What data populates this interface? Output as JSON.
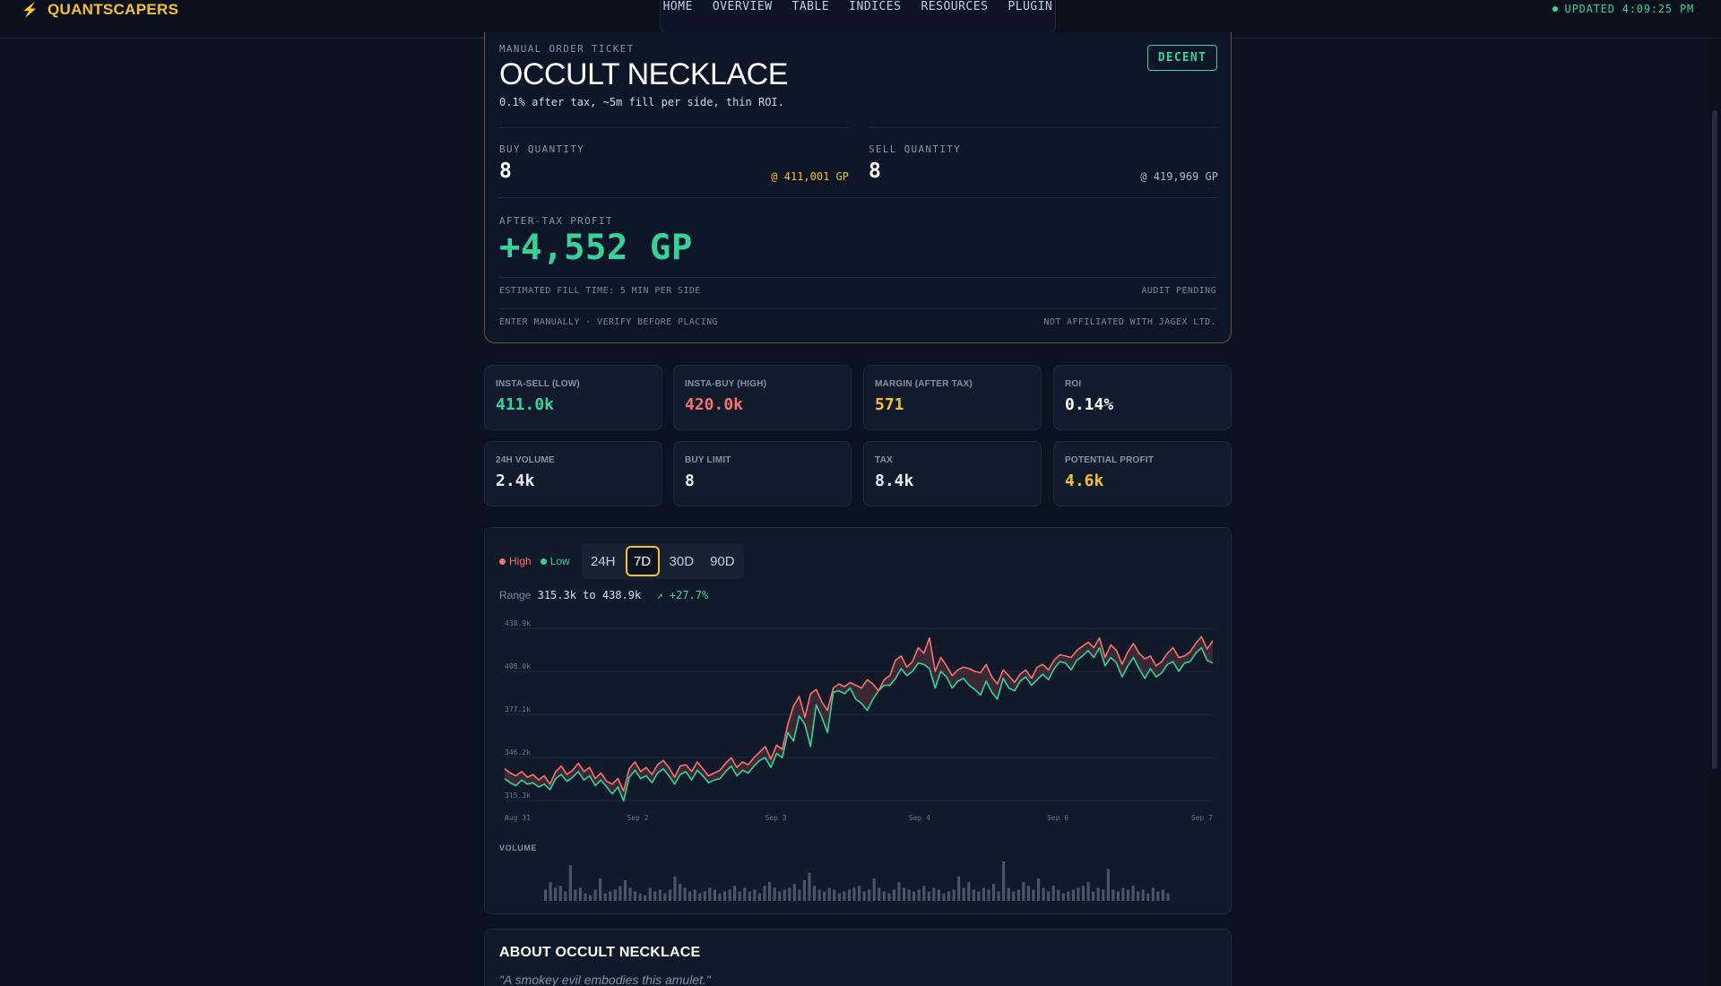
{
  "brand": {
    "name": "QUANTSCAPERS",
    "icon": "lightning-bolt-icon"
  },
  "nav": [
    "HOME",
    "OVERVIEW",
    "TABLE",
    "INDICES",
    "RESOURCES",
    "PLUGIN"
  ],
  "status": {
    "updated": "UPDATED 4:09:25 PM"
  },
  "ticket": {
    "eyebrow": "MANUAL ORDER TICKET",
    "title": "OCCULT NECKLACE",
    "subtitle": "0.1% after tax, ~5m fill per side, thin ROI.",
    "badge": "DECENT",
    "buy_label": "BUY QUANTITY",
    "buy_qty": "8",
    "buy_price": "@ 411,001 GP",
    "sell_label": "SELL QUANTITY",
    "sell_qty": "8",
    "sell_price": "@ 419,969 GP",
    "profit_label": "AFTER-TAX PROFIT",
    "profit": "+4,552 GP",
    "fill_time": "ESTIMATED FILL TIME: 5 MIN PER SIDE",
    "audit": "AUDIT PENDING",
    "manual_note": "ENTER MANUALLY · VERIFY BEFORE PLACING",
    "disclaimer": "NOT AFFILIATED WITH JAGEX LTD."
  },
  "stats": [
    {
      "label": "INSTA-SELL (LOW)",
      "value": "411.0k",
      "color": "#34d399"
    },
    {
      "label": "INSTA-BUY (HIGH)",
      "value": "420.0k",
      "color": "#f87171"
    },
    {
      "label": "MARGIN (AFTER TAX)",
      "value": "571",
      "color": "#f5c130"
    },
    {
      "label": "ROI",
      "value": "0.14%",
      "color": "#ffffff"
    },
    {
      "label": "24H VOLUME",
      "value": "2.4k",
      "color": "#e6ebf2"
    },
    {
      "label": "BUY LIMIT",
      "value": "8",
      "color": "#e6ebf2"
    },
    {
      "label": "TAX",
      "value": "8.4k",
      "color": "#e6ebf2"
    },
    {
      "label": "POTENTIAL PROFIT",
      "value": "4.6k",
      "color": "#f5c130"
    }
  ],
  "chart": {
    "legend_high": "High",
    "legend_low": "Low",
    "periods": [
      "24H",
      "7D",
      "30D",
      "90D"
    ],
    "active_period": "7D",
    "range_prefix": "Range",
    "range_text": "315.3k to 438.9k",
    "range_change": "↗ +27.7%",
    "volume_label": "VOLUME"
  },
  "chart_data": {
    "type": "line",
    "ylim": [
      315.3,
      438.9
    ],
    "y_ticks": [
      "438.9k",
      "408.0k",
      "377.1k",
      "346.2k",
      "315.3k"
    ],
    "x_ticks": [
      "Aug 31",
      "Sep 2",
      "Sep 3",
      "Sep 4",
      "Sep 6",
      "Sep 7"
    ],
    "x_tick_positions": [
      0,
      0.188,
      0.383,
      0.586,
      0.781,
      1.0
    ],
    "colors": {
      "high": "#f87171",
      "low": "#34d399",
      "volume": "#4b5563"
    },
    "series": [
      {
        "name": "High",
        "values": [
          338,
          335,
          333,
          336,
          332,
          334,
          330,
          333,
          327,
          336,
          340,
          334,
          337,
          342,
          336,
          339,
          331,
          335,
          329,
          327,
          331,
          322,
          338,
          343,
          336,
          339,
          334,
          341,
          344,
          339,
          332,
          340,
          341,
          336,
          343,
          338,
          333,
          335,
          337,
          342,
          346,
          339,
          343,
          341,
          346,
          350,
          354,
          345,
          355,
          352,
          370,
          383,
          390,
          375,
          392,
          395,
          386,
          380,
          396,
          399,
          397,
          400,
          398,
          396,
          402,
          399,
          394,
          402,
          405,
          416,
          419,
          411,
          415,
          425,
          421,
          432,
          408,
          418,
          412,
          405,
          409,
          411,
          410,
          408,
          407,
          413,
          404,
          399,
          409,
          405,
          400,
          406,
          409,
          403,
          411,
          413,
          409,
          416,
          420,
          419,
          418,
          423,
          426,
          429,
          425,
          432,
          418,
          427,
          423,
          413,
          422,
          428,
          421,
          417,
          419,
          412,
          415,
          421,
          425,
          418,
          419,
          422,
          428,
          433,
          424,
          430
        ],
        "note": ""
      },
      {
        "name": "Low",
        "values": [
          331,
          328,
          326,
          330,
          327,
          328,
          325,
          327,
          323,
          331,
          334,
          329,
          332,
          336,
          330,
          333,
          326,
          330,
          325,
          320,
          325,
          315,
          332,
          337,
          331,
          333,
          328,
          335,
          338,
          333,
          327,
          334,
          336,
          330,
          337,
          333,
          328,
          330,
          331,
          336,
          340,
          333,
          337,
          335,
          340,
          344,
          346,
          339,
          349,
          346,
          364,
          358,
          376,
          370,
          354,
          384,
          375,
          364,
          393,
          394,
          392,
          396,
          388,
          385,
          380,
          388,
          394,
          398,
          398,
          403,
          410,
          405,
          408,
          414,
          413,
          410,
          396,
          408,
          404,
          396,
          401,
          403,
          398,
          395,
          391,
          401,
          393,
          388,
          403,
          396,
          394,
          401,
          404,
          398,
          402,
          406,
          402,
          410,
          415,
          414,
          409,
          416,
          419,
          423,
          418,
          425,
          412,
          418,
          414,
          404,
          412,
          418,
          410,
          403,
          410,
          404,
          407,
          413,
          415,
          408,
          414,
          415,
          421,
          425,
          416,
          414
        ]
      }
    ],
    "volume": [
      12,
      20,
      14,
      16,
      10,
      38,
      12,
      14,
      8,
      6,
      12,
      24,
      8,
      10,
      12,
      16,
      22,
      14,
      10,
      8,
      6,
      14,
      10,
      12,
      8,
      12,
      26,
      18,
      14,
      10,
      12,
      8,
      10,
      14,
      12,
      8,
      10,
      12,
      16,
      10,
      14,
      10,
      12,
      8,
      16,
      20,
      14,
      10,
      12,
      14,
      18,
      12,
      22,
      30,
      16,
      12,
      10,
      14,
      12,
      8,
      10,
      12,
      14,
      16,
      10,
      12,
      24,
      14,
      10,
      8,
      12,
      20,
      14,
      12,
      10,
      12,
      16,
      10,
      14,
      12,
      8,
      10,
      12,
      26,
      14,
      20,
      12,
      10,
      14,
      12,
      18,
      10,
      42,
      14,
      10,
      12,
      20,
      16,
      12,
      24,
      14,
      10,
      16,
      12,
      8,
      10,
      12,
      14,
      16,
      20,
      10,
      14,
      12,
      34,
      12,
      10,
      14,
      12,
      16,
      10,
      12,
      8,
      14,
      10,
      12,
      8
    ]
  },
  "about": {
    "title": "ABOUT OCCULT NECKLACE",
    "quote": "\"A smokey evil embodies this amulet.\""
  }
}
